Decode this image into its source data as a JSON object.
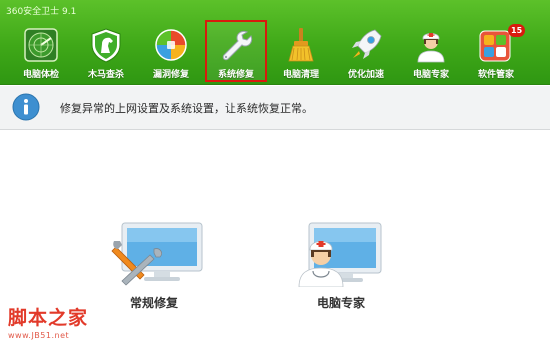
{
  "window": {
    "title": "360安全卫士 9.1"
  },
  "nav": {
    "items": [
      {
        "label": "电脑体检",
        "icon": "radar-check-icon",
        "selected": false
      },
      {
        "label": "木马查杀",
        "icon": "horse-shield-icon",
        "selected": false
      },
      {
        "label": "漏洞修复",
        "icon": "patch-ball-icon",
        "selected": false
      },
      {
        "label": "系统修复",
        "icon": "wrench-icon",
        "selected": true
      },
      {
        "label": "电脑清理",
        "icon": "broom-icon",
        "selected": false
      },
      {
        "label": "优化加速",
        "icon": "rocket-icon",
        "selected": false
      },
      {
        "label": "电脑专家",
        "icon": "doctor-icon",
        "selected": false
      },
      {
        "label": "软件管家",
        "icon": "software-grid-icon",
        "selected": false,
        "badge": "15"
      }
    ]
  },
  "info": {
    "icon": "info-icon",
    "text": "修复异常的上网设置及系统设置，让系统恢复正常。"
  },
  "cards": [
    {
      "label": "常规修复",
      "icon": "tools-monitor-icon"
    },
    {
      "label": "电脑专家",
      "icon": "doctor-monitor-icon"
    }
  ],
  "watermark": {
    "title": "脚本之家",
    "url": "www.JB51.net"
  },
  "colors": {
    "accent_green": "#3fa818",
    "selected_border": "#d91a0d",
    "watermark_red": "#e23a2a"
  }
}
